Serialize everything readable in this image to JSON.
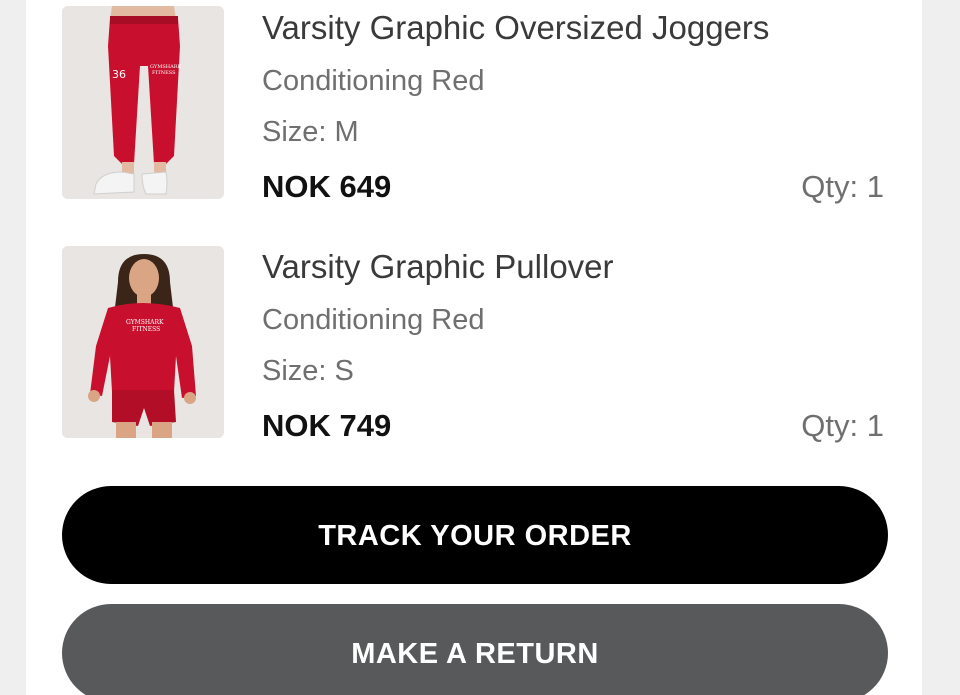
{
  "order_items": [
    {
      "name": "Varsity Graphic Oversized Joggers",
      "color": "Conditioning Red",
      "size": "Size: M",
      "price": "NOK 649",
      "qty": "Qty: 1",
      "image_alt": "red joggers product image",
      "image_text": "GYMSHARK FITNESS"
    },
    {
      "name": "Varsity Graphic Pullover",
      "color": "Conditioning Red",
      "size": "Size: S",
      "price": "NOK 749",
      "qty": "Qty: 1",
      "image_alt": "red pullover product image",
      "image_text": "GYMSHARK FITNESS"
    }
  ],
  "actions": {
    "track_label": "TRACK YOUR ORDER",
    "return_label": "MAKE A RETURN"
  },
  "colors": {
    "product_red": "#c8102e",
    "track_button": "#000000",
    "return_button": "#58595b"
  }
}
